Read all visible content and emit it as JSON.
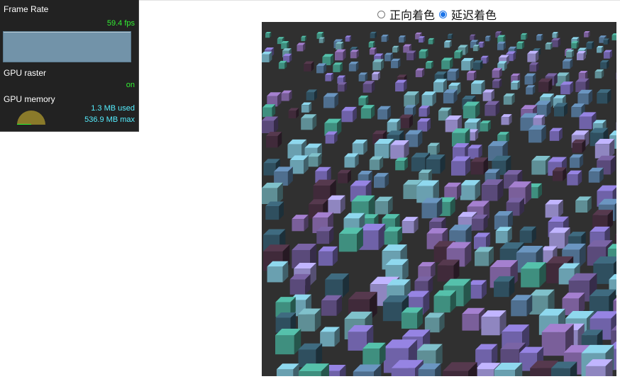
{
  "hud": {
    "frame_rate_label": "Frame Rate",
    "fps_value": "59.4 fps",
    "gpu_raster_label": "GPU raster",
    "gpu_raster_value": "on",
    "gpu_memory_label": "GPU memory",
    "memory_used": "1.3 MB used",
    "memory_max": "536.9 MB max",
    "memory_used_fraction": 0.0024,
    "colors": {
      "fps": "#33ee33",
      "memory": "#55eeff",
      "graph": "#7293a9",
      "gauge": "#8a7a2a"
    }
  },
  "render_modes": {
    "selected": "deferred",
    "options": [
      {
        "id": "forward",
        "label": "正向着色",
        "checked": false
      },
      {
        "id": "deferred",
        "label": "延迟着色",
        "checked": true
      }
    ]
  },
  "scene": {
    "background": "#303030",
    "cube_palette": [
      "#6f62a8",
      "#5f8f96",
      "#4f6f8f",
      "#7a5f9a",
      "#3f8f7f",
      "#8f86c0",
      "#5a4a7a",
      "#6aa0b0",
      "#402a3a",
      "#2f4f5f"
    ]
  }
}
